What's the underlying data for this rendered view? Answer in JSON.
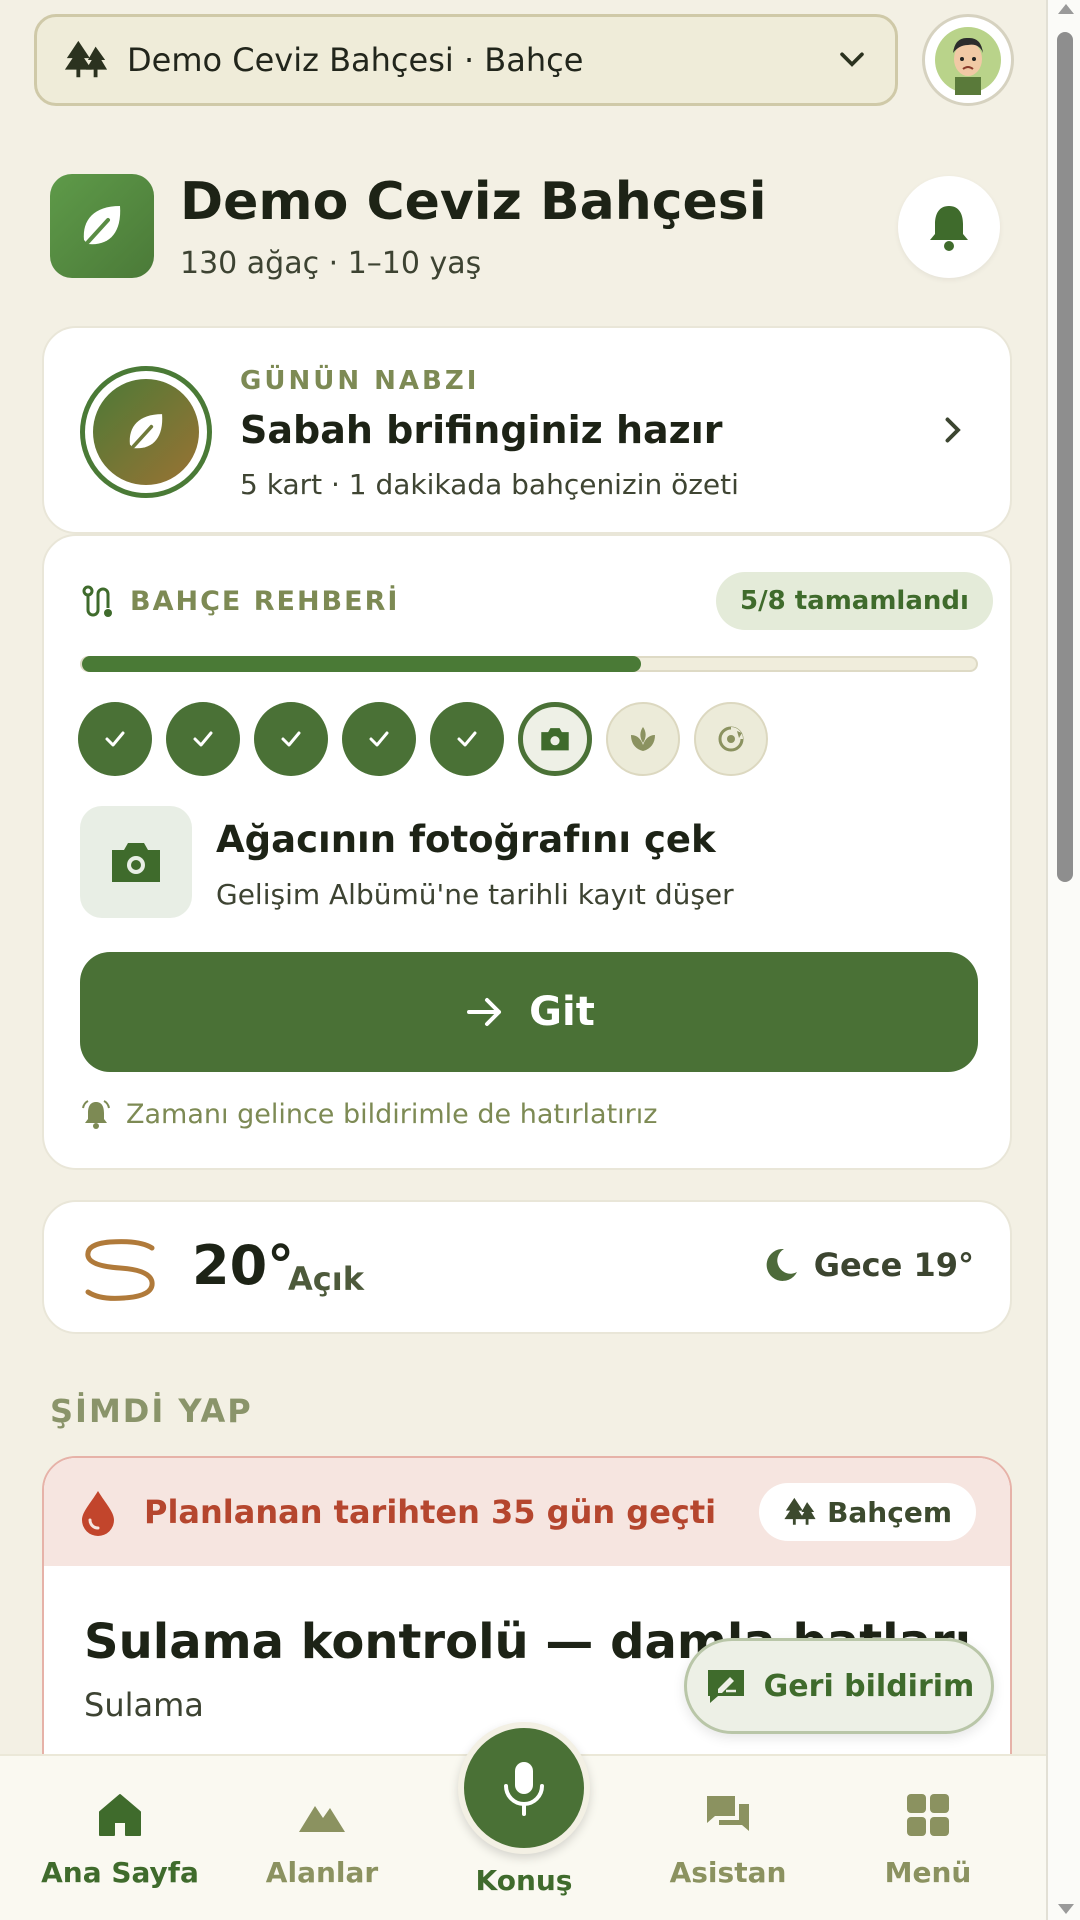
{
  "header": {
    "garden_selector": "Demo Ceviz Bahçesi · Bahçe",
    "garden_name": "Demo Ceviz Bahçesi",
    "garden_meta": "130 ağaç · 1–10 yaş"
  },
  "pulse": {
    "eyebrow": "GÜNÜN NABZI",
    "title": "Sabah brifinginiz hazır",
    "subtitle": "5 kart · 1 dakikada bahçenizin özeti"
  },
  "guide": {
    "title": "BAHÇE REHBERİ",
    "badge": "5/8 tamamlandı",
    "progress": 0.625,
    "steps": [
      "done",
      "done",
      "done",
      "done",
      "done",
      "current",
      "todo",
      "todo"
    ],
    "task_title": "Ağacının fotoğrafını çek",
    "task_subtitle": "Gelişim Albümü'ne tarihli kayıt düşer",
    "go_label": "Git",
    "reminder": "Zamanı gelince bildirimle de hatırlatırız"
  },
  "weather": {
    "temp": "20°",
    "condition": "Açık",
    "night": "Gece 19°"
  },
  "now": {
    "section_label": "ŞİMDİ YAP",
    "overdue_msg": "Planlanan tarihten 35 gün geçti",
    "tag": "Bahçem",
    "task_title": "Sulama kontrolü — damla batları",
    "category": "Sulama"
  },
  "feedback_label": "Geri bildirim",
  "nav": {
    "home": "Ana Sayfa",
    "areas": "Alanlar",
    "talk": "Konuş",
    "assistant": "Asistan",
    "menu": "Menü"
  },
  "colors": {
    "primary": "#4a7136",
    "background": "#f3f0e4",
    "danger": "#b5462e",
    "muted": "#7d8a54"
  }
}
